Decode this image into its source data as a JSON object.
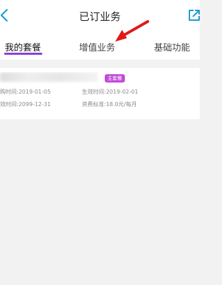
{
  "header": {
    "title": "已订业务",
    "back_icon": "chevron-left-icon",
    "share_icon": "external-link-icon",
    "accent_color": "#1a9bd7"
  },
  "tabs": [
    {
      "label": "我的套餐",
      "active": true
    },
    {
      "label": "增值业务",
      "active": false
    },
    {
      "label": "基础功能",
      "active": false
    }
  ],
  "active_tab_color": "#8a3ed6",
  "package": {
    "badge": "主套餐",
    "badge_color": "#c14bd8",
    "order_time": "购时间:2019-01-05",
    "effective_time": "生效时间:2019-02-01",
    "expire_time": "效时间:2099-12-31",
    "fee_standard": "资费标准:18.0元/每月"
  },
  "annotation": {
    "arrow_color": "#e01919"
  }
}
